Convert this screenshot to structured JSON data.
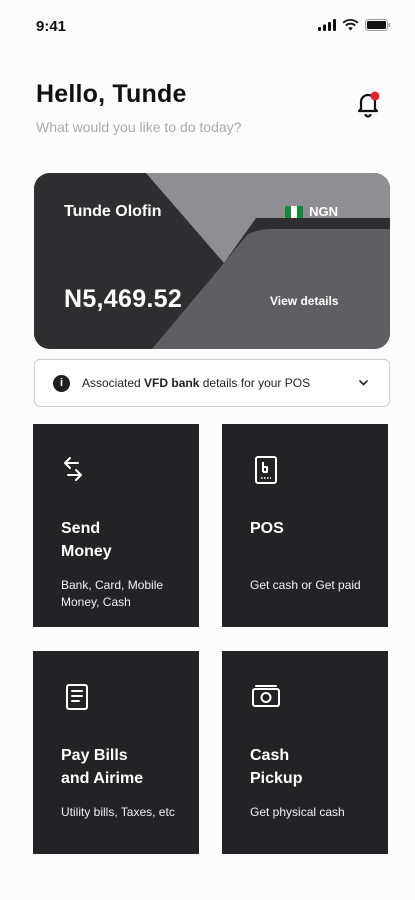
{
  "status_bar": {
    "time": "9:41"
  },
  "header": {
    "greeting": "Hello, Tunde",
    "subtitle": "What would you like to do today?"
  },
  "balance_card": {
    "account_name": "Tunde Olofin",
    "currency": "NGN",
    "balance": "N5,469.52",
    "view_details_label": "View details"
  },
  "info_bar": {
    "icon_label": "i",
    "text_before": "Associated ",
    "text_bold": "VFD bank",
    "text_after": " details for your POS"
  },
  "tiles": [
    {
      "title": "Send\nMoney",
      "description": "Bank, Card, Mobile Money, Cash",
      "icon": "transfer-arrows-icon"
    },
    {
      "title": "POS",
      "description": "Get cash or Get paid",
      "icon": "pos-terminal-icon"
    },
    {
      "title": "Pay Bills\nand Airime",
      "description": "Utility bills, Taxes, etc",
      "icon": "bill-document-icon"
    },
    {
      "title": "Cash\nPickup",
      "description": "Get physical cash",
      "icon": "cash-note-icon"
    }
  ],
  "colors": {
    "tile_background": "#232325",
    "card_dark": "#2e2e31",
    "card_mid": "#5f5f63",
    "card_light": "#8f8f93",
    "notification_dot": "#e0262b",
    "flag_green": "#128a3e"
  }
}
